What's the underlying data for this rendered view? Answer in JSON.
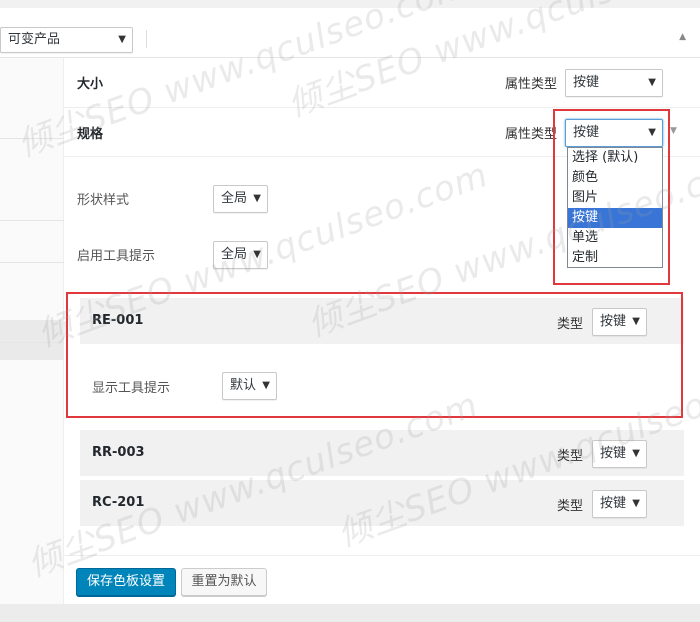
{
  "header": {
    "product_type": "可变产品"
  },
  "attributes": [
    {
      "name": "大小",
      "type_label": "属性类型",
      "type_value": "按键"
    },
    {
      "name": "规格",
      "type_label": "属性类型",
      "type_value": "按键"
    }
  ],
  "dropdown_options": [
    "选择 (默认)",
    "颜色",
    "图片",
    "按键",
    "单选",
    "定制"
  ],
  "settings": {
    "shape_label": "形状样式",
    "shape_value": "全局",
    "tooltip_label": "启用工具提示",
    "tooltip_value": "全局"
  },
  "terms": [
    {
      "name": "RE-001",
      "type_label": "类型",
      "type_value": "按键",
      "tooltip_label": "显示工具提示",
      "tooltip_value": "默认"
    },
    {
      "name": "RR-003",
      "type_label": "类型",
      "type_value": "按键"
    },
    {
      "name": "RC-201",
      "type_label": "类型",
      "type_value": "按键"
    }
  ],
  "buttons": {
    "save": "保存色板设置",
    "reset": "重置为默认"
  },
  "watermark": "倾尘SEO www.qculseo.com",
  "colors": {
    "primary_button": "#0085ba",
    "highlight_box": "#e0383c",
    "selected_option": "#3875d7"
  }
}
